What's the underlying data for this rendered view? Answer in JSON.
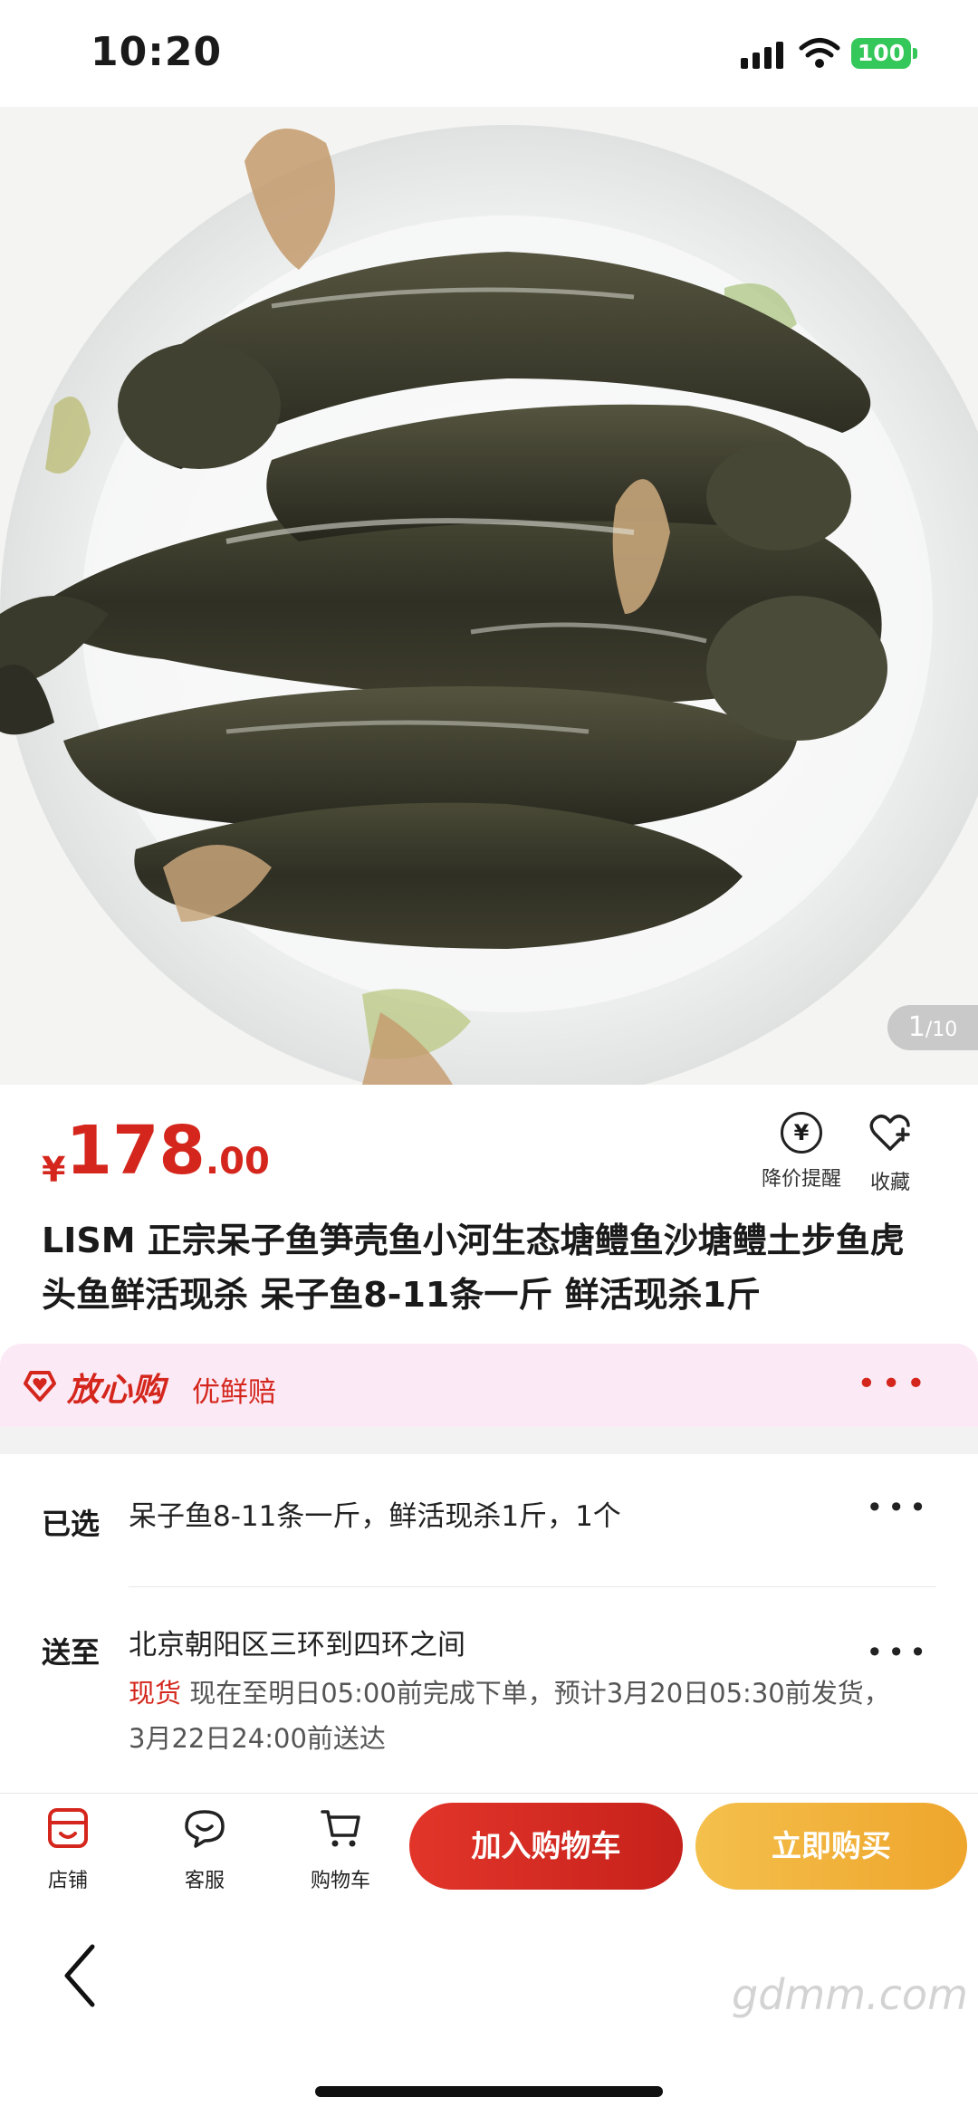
{
  "status_bar": {
    "time": "10:20",
    "battery": "100"
  },
  "gallery": {
    "current": "1",
    "total": "/10"
  },
  "price": {
    "symbol": "¥",
    "integer": "178",
    "decimal": ".00"
  },
  "actions": {
    "price_alert": "降价提醒",
    "favorite": "收藏",
    "price_alert_symbol": "¥"
  },
  "product": {
    "title": "LISM 正宗呆子鱼笋壳鱼小河生态塘鳢鱼沙塘鳢土步鱼虎头鱼鲜活现杀 呆子鱼8-11条一斤 鲜活现杀1斤"
  },
  "promise": {
    "brand": "放心购",
    "sub": "优鲜赔"
  },
  "selected": {
    "label": "已选",
    "value": "呆子鱼8-11条一斤，鲜活现杀1斤，1个"
  },
  "delivery": {
    "label": "送至",
    "address": "北京朝阳区三环到四环之间",
    "stock": "现货",
    "note": " 现在至明日05:00前完成下单，预计3月20日05:30前发货，3月22日24:00前送达"
  },
  "bottom_bar": {
    "shop": "店铺",
    "service": "客服",
    "cart": "购物车",
    "add_to_cart": "加入购物车",
    "buy_now": "立即购买"
  },
  "watermark": "gdmm.com",
  "colors": {
    "accent": "#d4261c",
    "buy": "#f0ae36",
    "promise_bg": "#fbeaf6"
  }
}
